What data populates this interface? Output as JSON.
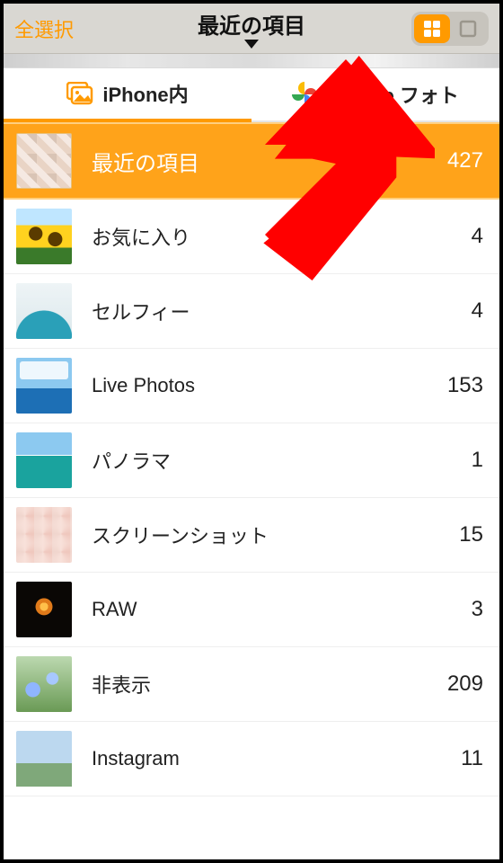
{
  "header": {
    "select_all_label": "全選択",
    "title": "最近の項目"
  },
  "tabs": {
    "iphone_label": "iPhone内",
    "google_label": "Google フォト"
  },
  "albums": [
    {
      "label": "最近の項目",
      "count": "427",
      "thumb": "th-grid",
      "selected": true
    },
    {
      "label": "お気に入り",
      "count": "4",
      "thumb": "th-sunflower",
      "selected": false
    },
    {
      "label": "セルフィー",
      "count": "4",
      "thumb": "th-selfie",
      "selected": false
    },
    {
      "label": "Live Photos",
      "count": "153",
      "thumb": "th-sea",
      "selected": false
    },
    {
      "label": "パノラマ",
      "count": "1",
      "thumb": "th-panorama",
      "selected": false
    },
    {
      "label": "スクリーンショット",
      "count": "15",
      "thumb": "th-screens",
      "selected": false
    },
    {
      "label": "RAW",
      "count": "3",
      "thumb": "th-fire",
      "selected": false
    },
    {
      "label": "非表示",
      "count": "209",
      "thumb": "th-flowers",
      "selected": false
    },
    {
      "label": "Instagram",
      "count": "11",
      "thumb": "th-fuji",
      "selected": false
    }
  ],
  "colors": {
    "accent": "#ff9a00",
    "arrow": "#ff0000"
  }
}
